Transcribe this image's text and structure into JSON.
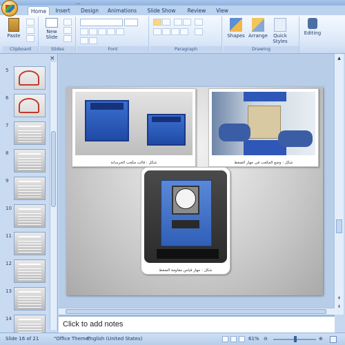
{
  "window": {
    "title": "..."
  },
  "ribbon": {
    "tabs": [
      "Home",
      "Insert",
      "Design",
      "Animations",
      "Slide Show",
      "Review",
      "View"
    ],
    "active_tab": "Home",
    "groups": {
      "clipboard": {
        "label": "Clipboard",
        "paste": "Paste"
      },
      "slides": {
        "label": "Slides",
        "new_slide_1": "New",
        "new_slide_2": "Slide"
      },
      "font": {
        "label": "Font"
      },
      "paragraph": {
        "label": "Paragraph"
      },
      "drawing": {
        "label": "Drawing",
        "shapes": "Shapes",
        "arrange": "Arrange",
        "quick_styles_1": "Quick",
        "quick_styles_2": "Styles"
      },
      "editing": {
        "label": "Editing"
      }
    }
  },
  "slides_pane": {
    "items": [
      {
        "num": "5",
        "style": "red"
      },
      {
        "num": "6",
        "style": "red"
      },
      {
        "num": "7",
        "style": "gray"
      },
      {
        "num": "8",
        "style": "gray"
      },
      {
        "num": "9",
        "style": "gray"
      },
      {
        "num": "10",
        "style": "gray"
      },
      {
        "num": "11",
        "style": "gray"
      },
      {
        "num": "12",
        "style": "gray"
      },
      {
        "num": "13",
        "style": "gray"
      },
      {
        "num": "14",
        "style": "gray"
      }
    ]
  },
  "slide": {
    "photos": [
      {
        "caption": "شكل : قالب مكعب الخرسانة"
      },
      {
        "caption": "شكل : وضع المكعب في جهاز الضغط"
      },
      {
        "caption": "شكل : جهاز قياس مقاومة الضغط"
      }
    ]
  },
  "notes": {
    "placeholder": "Click to add notes"
  },
  "status": {
    "slide_info": "Slide 16 of 21",
    "theme": "\"Office Theme\"",
    "language": "English (United States)",
    "zoom": "61%"
  },
  "colors": {
    "ribbon_bg": "#dce8f8",
    "accent": "#2f6fd0",
    "canvas_bg": "#b8cde8"
  }
}
